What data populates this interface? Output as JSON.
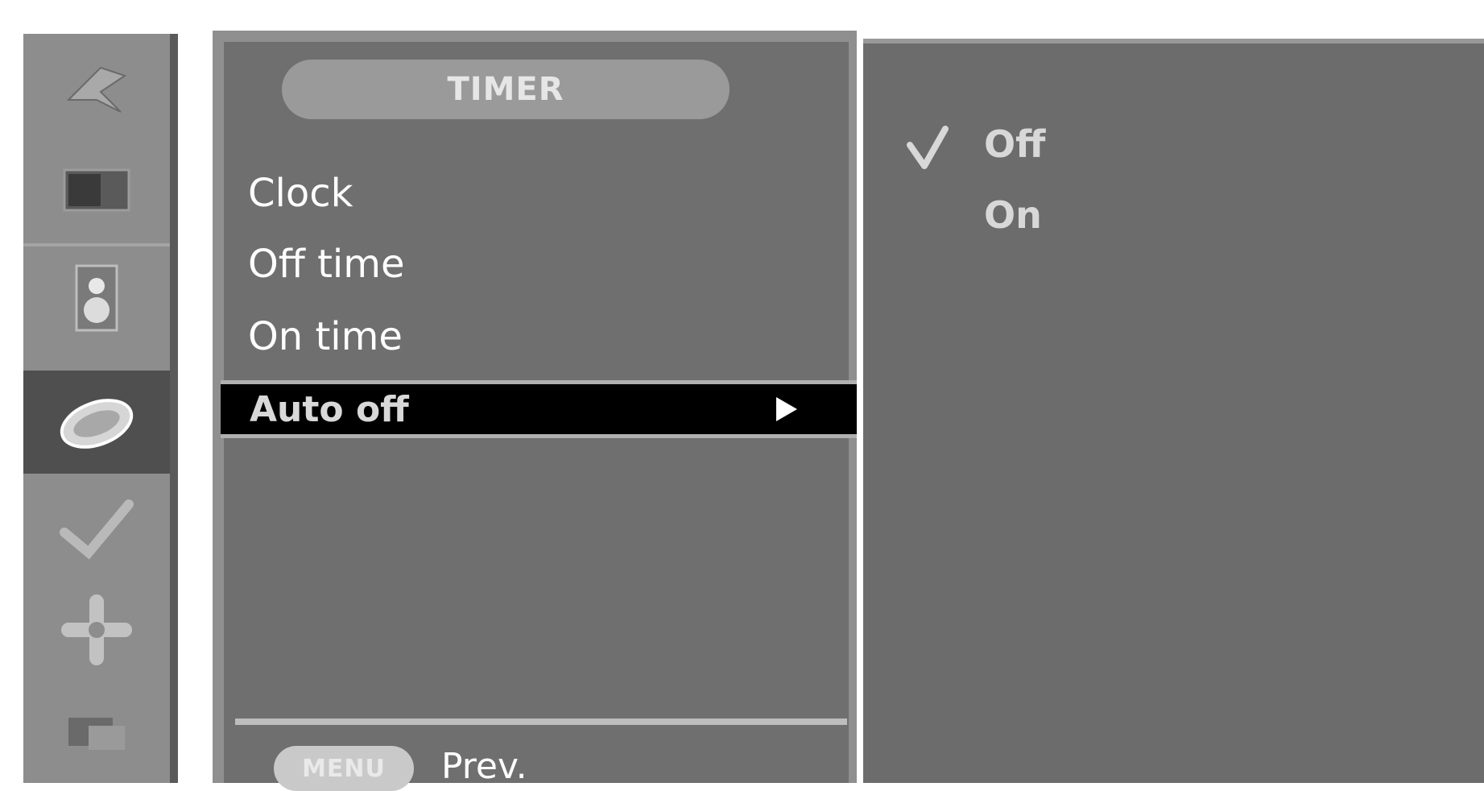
{
  "rail": {
    "icons": [
      {
        "name": "station-icon"
      },
      {
        "name": "picture-icon"
      },
      {
        "name": "sound-icon"
      },
      {
        "name": "time-icon",
        "active": true
      },
      {
        "name": "option-icon"
      },
      {
        "name": "screen-icon"
      },
      {
        "name": "pip-icon"
      }
    ]
  },
  "menu": {
    "title": "TIMER",
    "items": [
      "Clock",
      "Off time",
      "On time"
    ],
    "selected_item": "Auto off",
    "footer": {
      "menu_button": "MENU",
      "prev_label": "Prev."
    }
  },
  "options": {
    "items": [
      {
        "label": "Off",
        "checked": true
      },
      {
        "label": "On",
        "checked": false
      }
    ]
  },
  "colors": {
    "rail": "#8d8d8d",
    "rail_active": "#4f4f4f",
    "panel": "#6f6f6f",
    "highlight": "#000000",
    "text": "#ffffff"
  }
}
